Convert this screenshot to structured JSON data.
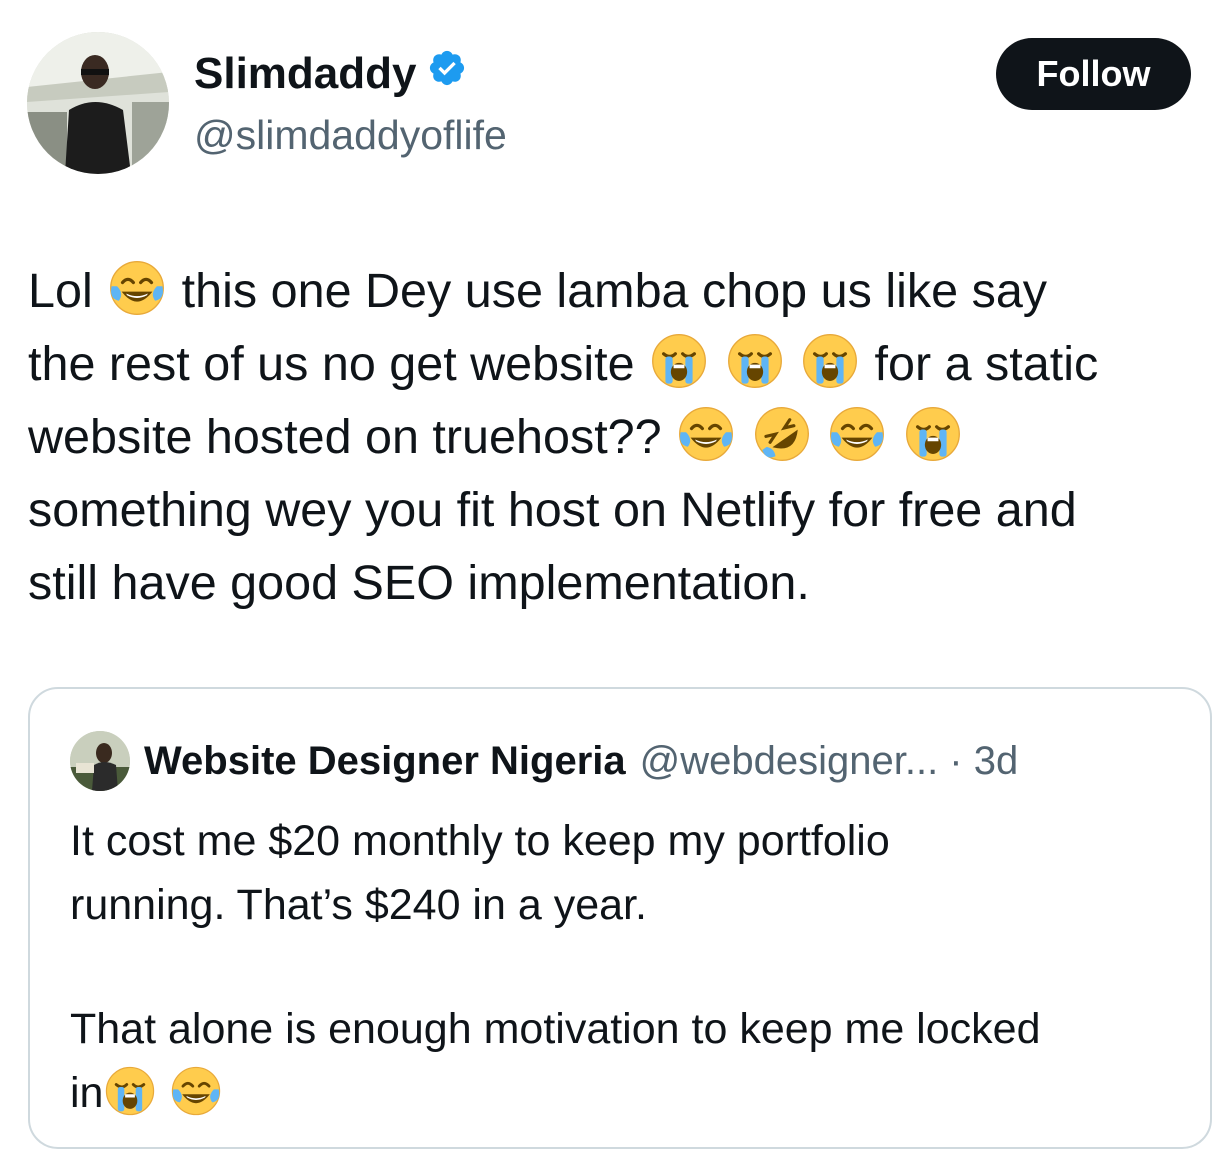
{
  "author": {
    "name": "Slimdaddy",
    "handle": "@slimdaddyoflife",
    "verified": true,
    "verified_color": "#1d9bf0"
  },
  "follow_button": {
    "label": "Follow"
  },
  "tweet": {
    "lines": [
      [
        "Lol ",
        "joy",
        " this one Dey use lamba chop us like say"
      ],
      [
        "the rest of us no get website ",
        "sob",
        " ",
        "sob",
        " ",
        "sob",
        " for a static"
      ],
      [
        "website hosted on truehost?? ",
        "joy",
        " ",
        "rofl",
        " ",
        "joy",
        " ",
        "sob"
      ],
      [
        "something wey you fit host on Netlify for free and"
      ],
      [
        "still have good SEO implementation."
      ]
    ],
    "emoji_names": {
      "joy": "face-with-tears-of-joy-icon",
      "sob": "loudly-crying-face-icon",
      "rofl": "rolling-on-floor-laughing-icon"
    }
  },
  "quote": {
    "author_name": "Website Designer Nigeria",
    "handle_time": "@webdesigner... · 3d",
    "paragraph1_line1": "It cost me $20 monthly to keep my portfolio",
    "paragraph1_line2": "running. That’s $240 in a year.",
    "paragraph2_line1": "That alone is enough motivation to keep me locked",
    "paragraph2_line2": "in"
  }
}
